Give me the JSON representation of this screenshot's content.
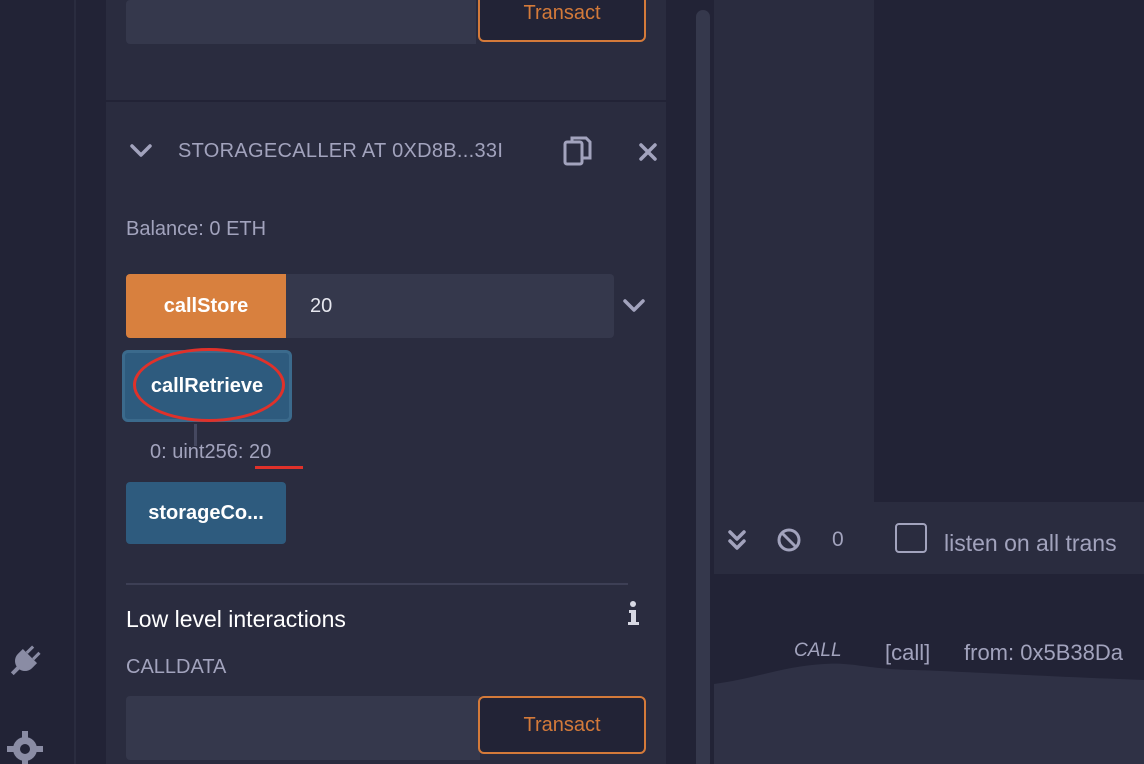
{
  "top_section": {
    "transact_label": "Transact"
  },
  "contract": {
    "title": "STORAGECALLER AT 0XD8B...33I",
    "icons": {
      "expand": "chevron-down-icon",
      "copy": "copy-icon",
      "close": "close-icon"
    },
    "balance": "Balance: 0 ETH"
  },
  "functions": {
    "call_store": {
      "label": "callStore",
      "value": "20"
    },
    "call_retrieve": {
      "label": "callRetrieve"
    },
    "retrieve_output": {
      "prefix": "0: uint256:",
      "value": "20"
    },
    "storage_contract": {
      "label": "storageCo..."
    }
  },
  "low_level": {
    "title": "Low level interactions",
    "info_icon": "info-icon",
    "calldata_label": "CALLDATA",
    "transact_label": "Transact"
  },
  "terminal": {
    "pending_count": "0",
    "listen_label": "listen on all trans",
    "log": {
      "tag": "CALL",
      "kind": "[call]",
      "from": "from: 0x5B38Da"
    }
  },
  "colors": {
    "accent_orange": "#d8803e",
    "button_blue": "#2e5b7e",
    "annotation_red": "#e0312a",
    "panel_bg": "#2a2c3f",
    "page_bg": "#222336"
  }
}
